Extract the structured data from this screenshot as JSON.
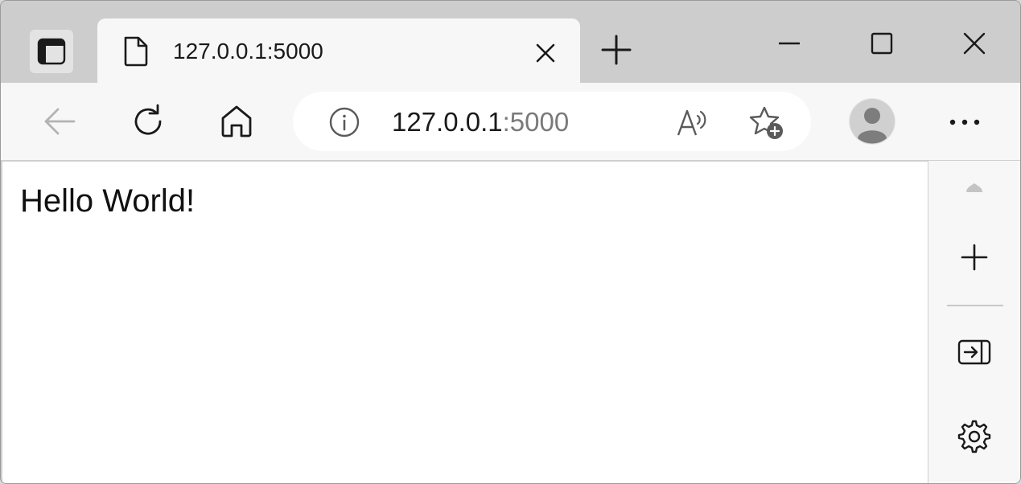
{
  "tab": {
    "title": "127.0.0.1:5000",
    "icon": "page-icon",
    "close_icon": "close-icon"
  },
  "address_bar": {
    "host": "127.0.0.1",
    "port": ":5000",
    "info_icon": "info-icon",
    "read_aloud_icon": "read-aloud-icon",
    "favorites_icon": "add-favorite-icon"
  },
  "toolbar": {
    "back_icon": "back-arrow-icon",
    "refresh_icon": "refresh-icon",
    "home_icon": "home-icon",
    "profile_icon": "profile-avatar-icon",
    "more_icon": "more-icon"
  },
  "window_controls": {
    "minimize_icon": "minimize-icon",
    "maximize_icon": "maximize-icon",
    "close_icon": "close-icon"
  },
  "page": {
    "text": "Hello World!"
  },
  "sidebar": {
    "items": [
      {
        "icon": "collapse-up-icon"
      },
      {
        "icon": "plus-icon"
      },
      {
        "icon": "hide-sidebar-icon"
      },
      {
        "icon": "gear-icon"
      }
    ]
  },
  "colors": {
    "tabstrip_bg": "#cdcdcd",
    "toolbar_bg": "#f7f7f7",
    "port_text": "#7a7a7a"
  }
}
